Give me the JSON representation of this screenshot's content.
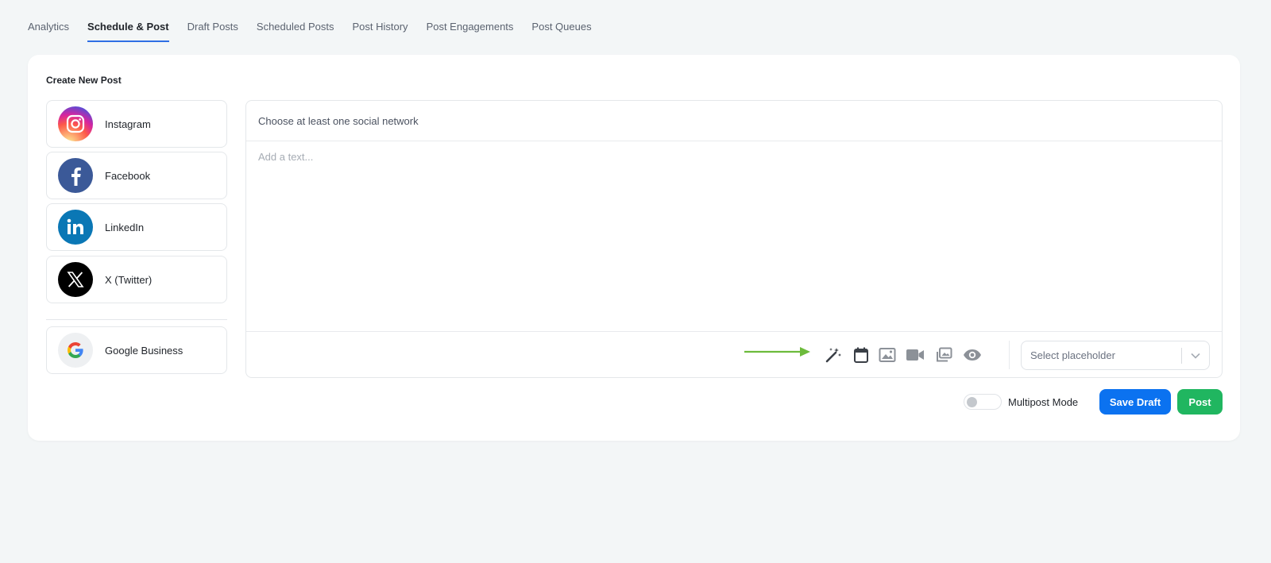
{
  "tabs": [
    {
      "label": "Analytics",
      "active": false
    },
    {
      "label": "Schedule & Post",
      "active": true
    },
    {
      "label": "Draft Posts",
      "active": false
    },
    {
      "label": "Scheduled Posts",
      "active": false
    },
    {
      "label": "Post History",
      "active": false
    },
    {
      "label": "Post Engagements",
      "active": false
    },
    {
      "label": "Post Queues",
      "active": false
    }
  ],
  "card": {
    "title": "Create New Post"
  },
  "networks": [
    {
      "name": "Instagram",
      "icon": "instagram-icon"
    },
    {
      "name": "Facebook",
      "icon": "facebook-icon",
      "color": "#3b5998"
    },
    {
      "name": "LinkedIn",
      "icon": "linkedin-icon",
      "color": "#0a77b5"
    },
    {
      "name": "X (Twitter)",
      "icon": "x-twitter-icon",
      "color": "#000000"
    },
    {
      "name": "Google Business",
      "icon": "google-icon"
    }
  ],
  "composer": {
    "network_hint": "Choose at least one social network",
    "text_placeholder": "Add a text...",
    "placeholder_select": "Select placeholder",
    "tools": [
      "magic-wand-icon",
      "calendar-icon",
      "image-icon",
      "video-icon",
      "gallery-icon",
      "preview-eye-icon"
    ]
  },
  "footer": {
    "multipost_label": "Multipost Mode",
    "multipost_enabled": false,
    "save_draft_label": "Save Draft",
    "post_label": "Post"
  },
  "colors": {
    "accent_tab": "#2f6fe4",
    "save_button": "#0b72f0",
    "post_button": "#20b660",
    "arrow": "#6dbb3c"
  }
}
